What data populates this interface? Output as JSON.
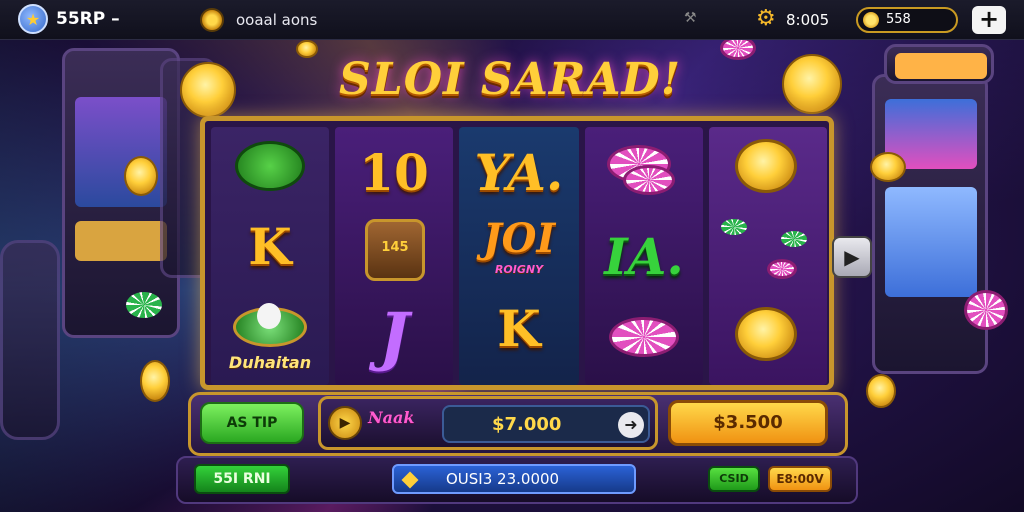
{
  "topbar": {
    "player_name": "55RP –",
    "bonus_label": "ooaal aons",
    "gems_value": "8:005",
    "balance_value": "558",
    "plus_label": "+"
  },
  "game": {
    "title": "SLOI SARAD!"
  },
  "reels": {
    "reel1": {
      "mid": "K",
      "label": "Duhaitan"
    },
    "reel2": {
      "top": "10",
      "mid_label": "JOI",
      "mid_sub": "ROIGNY",
      "bot": "J",
      "barrel_label": "145"
    },
    "reel3": {
      "top": "YA.",
      "bot": "K"
    },
    "reel4": {
      "mid": "IA."
    }
  },
  "controls": {
    "autospin_label": "AS TIP",
    "brand_label": "Naak",
    "bet_value": "$7.000",
    "arrow_glyph": "➜",
    "spin_label": "$3.500",
    "play_glyph": "▶"
  },
  "bottom": {
    "level_label": "55I RNI",
    "win_value": "OUSI3 23.0000",
    "small_green_label": "CSID",
    "small_orange_label": "E8:00V"
  },
  "colors": {
    "accent_gold": "#ffcf3a",
    "frame_gold": "#c8962c",
    "green": "#2aa821",
    "blue": "#2b62d6"
  }
}
